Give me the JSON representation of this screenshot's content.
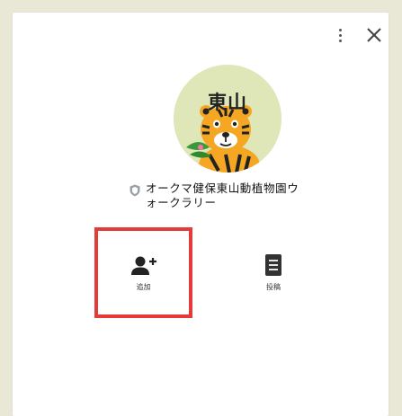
{
  "header": {
    "more_icon": "more-vertical-icon",
    "close_icon": "close-icon"
  },
  "profile": {
    "avatar_text": "東山",
    "avatar_description_icon": "tiger-mascot",
    "verified_icon": "shield-icon",
    "name": "オークマ健保東山動植物園ウォークラリー"
  },
  "actions": [
    {
      "label": "追加",
      "icon": "add-person-icon",
      "highlighted": true
    },
    {
      "label": "投稿",
      "icon": "post-list-icon",
      "highlighted": false
    }
  ],
  "colors": {
    "background": "#e9e8d6",
    "panel": "#ffffff",
    "highlight_border": "#e53a3a",
    "avatar_bg": "#d8e0a8",
    "tiger": "#f5a623"
  }
}
